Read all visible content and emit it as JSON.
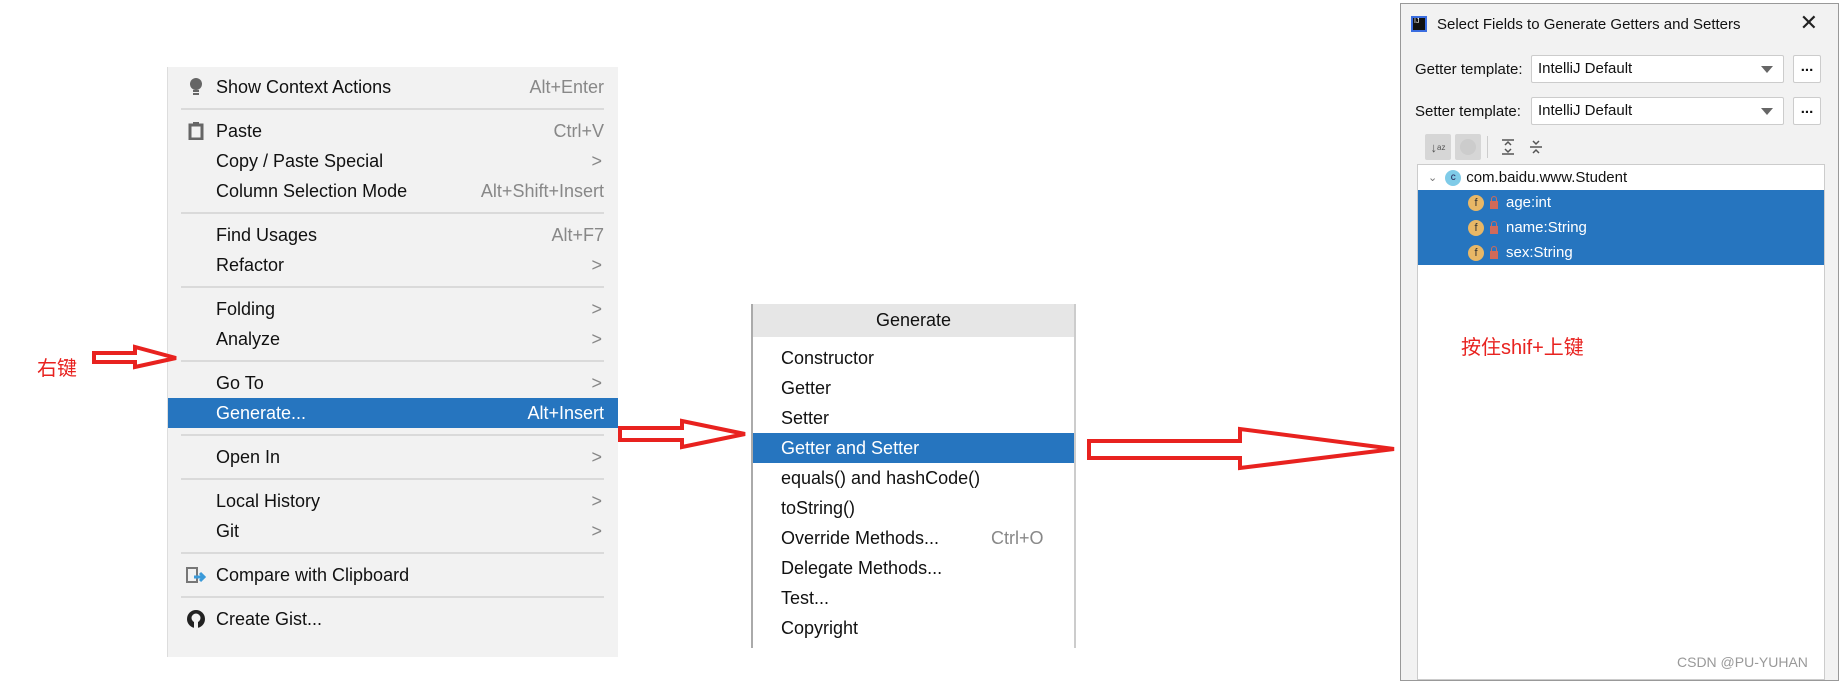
{
  "context_menu": {
    "items": [
      {
        "label": "Show Context Actions",
        "shortcut": "Alt+Enter",
        "icon": "lightbulb-icon"
      },
      {
        "label": "Paste",
        "shortcut": "Ctrl+V",
        "icon": "clipboard-icon"
      },
      {
        "label": "Copy / Paste Special",
        "submenu": true
      },
      {
        "label": "Column Selection Mode",
        "shortcut": "Alt+Shift+Insert"
      },
      {
        "label": "Find Usages",
        "shortcut": "Alt+F7"
      },
      {
        "label": "Refactor",
        "submenu": true
      },
      {
        "label": "Folding",
        "submenu": true
      },
      {
        "label": "Analyze",
        "submenu": true
      },
      {
        "label": "Go To",
        "submenu": true
      },
      {
        "label": "Generate...",
        "shortcut": "Alt+Insert",
        "selected": true
      },
      {
        "label": "Open In",
        "submenu": true
      },
      {
        "label": "Local History",
        "submenu": true
      },
      {
        "label": "Git",
        "submenu": true
      },
      {
        "label": "Compare with Clipboard",
        "icon": "compare-clipboard-icon"
      },
      {
        "label": "Create Gist...",
        "icon": "github-icon"
      }
    ],
    "submenu_glyph": ">"
  },
  "generate_popup": {
    "title": "Generate",
    "items": [
      {
        "label": "Constructor"
      },
      {
        "label": "Getter"
      },
      {
        "label": "Setter"
      },
      {
        "label": "Getter and Setter",
        "selected": true
      },
      {
        "label": "equals() and hashCode()"
      },
      {
        "label": "toString()"
      },
      {
        "label": "Override Methods...",
        "shortcut": "Ctrl+O"
      },
      {
        "label": "Delegate Methods..."
      },
      {
        "label": "Test..."
      },
      {
        "label": "Copyright"
      }
    ]
  },
  "dialog": {
    "title": "Select Fields to Generate Getters and Setters",
    "close": "✕",
    "getter_label": "Getter template:",
    "getter_value": "IntelliJ Default",
    "setter_label": "Setter template:",
    "setter_value": "IntelliJ Default",
    "more": "...",
    "class_name": "com.baidu.www.Student",
    "class_badge": "c",
    "field_badge": "f",
    "fields": [
      "age:int",
      "name:String",
      "sex:String"
    ]
  },
  "annotations": {
    "right_click": "右键",
    "shift_hint": "按住shif+上键",
    "watermark": "CSDN @PU-YUHAN"
  },
  "colors": {
    "selection": "#2675bf",
    "annotation": "#e8221f",
    "menu_bg": "#f2f2f2"
  }
}
